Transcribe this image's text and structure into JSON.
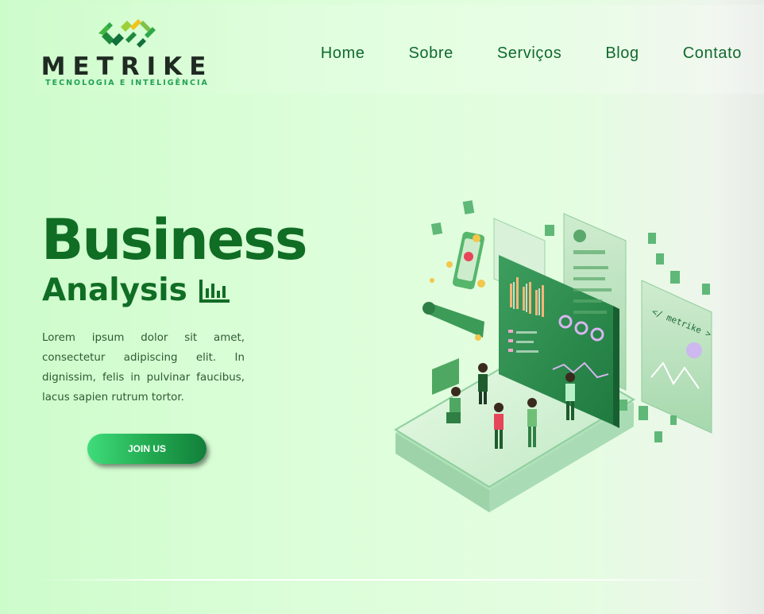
{
  "brand": {
    "name": "METRIKE",
    "tagline": "TECNOLOGIA E INTELIGÊNCIA",
    "colors": {
      "primary": "#106d24",
      "accent": "#23a155",
      "dark": "#1f2a22"
    }
  },
  "nav": {
    "items": [
      {
        "label": "Home"
      },
      {
        "label": "Sobre"
      },
      {
        "label": "Serviços"
      },
      {
        "label": "Blog"
      },
      {
        "label": "Contato"
      }
    ]
  },
  "hero": {
    "title": "Business",
    "subtitle": "Analysis",
    "subtitle_icon": "bar-chart-icon",
    "text": "Lorem ipsum dolor sit amet, consectetur adipiscing elit. In dignissim, felis in pulvinar faucibus, lacus sapien rutrum tortor.",
    "cta_label": "JOIN US"
  },
  "illustration": {
    "description_icon": "isometric-analytics-illustration-icon",
    "sign_text": "</ metrike >"
  }
}
